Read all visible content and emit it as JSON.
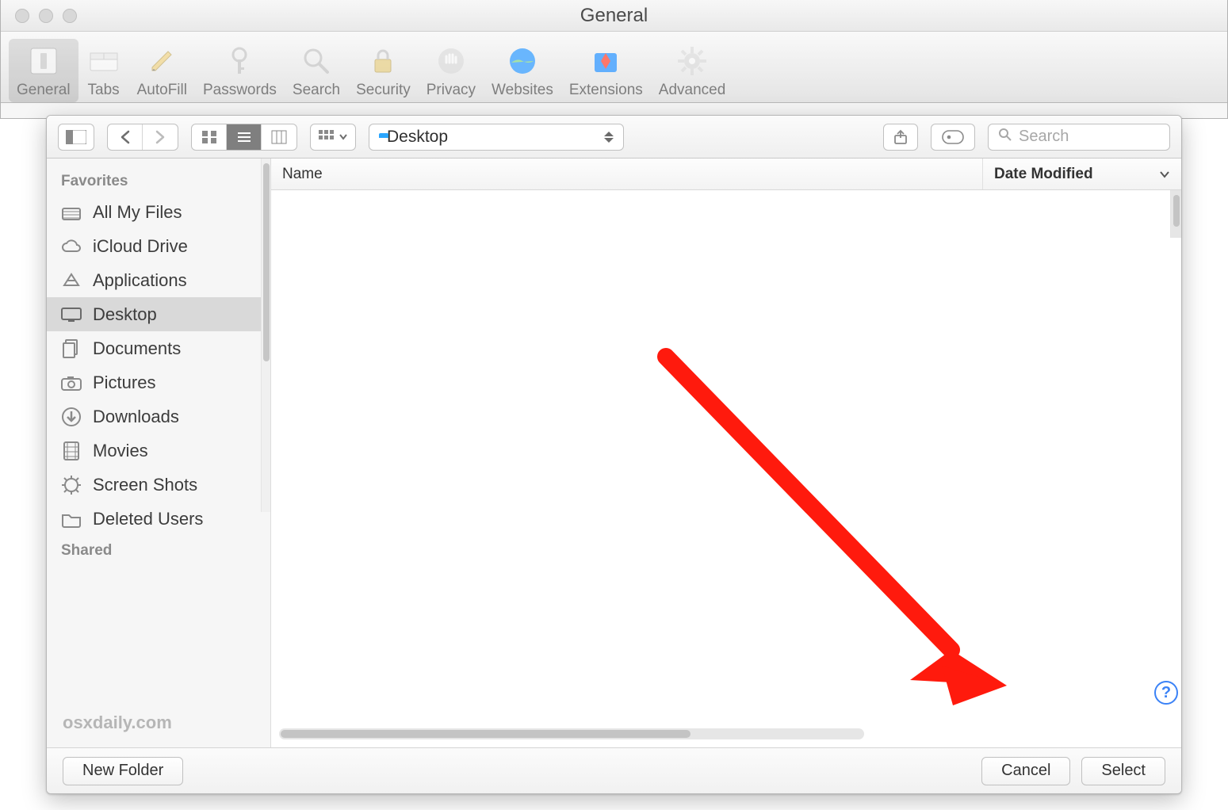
{
  "window": {
    "title": "General"
  },
  "prefs_tabs": {
    "general": "General",
    "tabs": "Tabs",
    "autofill": "AutoFill",
    "passwords": "Passwords",
    "search": "Search",
    "security": "Security",
    "privacy": "Privacy",
    "websites": "Websites",
    "extensions": "Extensions",
    "advanced": "Advanced",
    "selected": "general"
  },
  "open_panel": {
    "location": "Desktop",
    "search_placeholder": "Search",
    "columns": {
      "name": "Name",
      "date_modified": "Date Modified"
    },
    "sidebar": {
      "favorites_heading": "Favorites",
      "shared_heading": "Shared",
      "items": [
        {
          "id": "all-my-files",
          "label": "All My Files",
          "icon": "all-files-icon"
        },
        {
          "id": "icloud-drive",
          "label": "iCloud Drive",
          "icon": "cloud-icon"
        },
        {
          "id": "applications",
          "label": "Applications",
          "icon": "applications-icon"
        },
        {
          "id": "desktop",
          "label": "Desktop",
          "icon": "desktop-icon",
          "selected": true
        },
        {
          "id": "documents",
          "label": "Documents",
          "icon": "documents-icon"
        },
        {
          "id": "pictures",
          "label": "Pictures",
          "icon": "camera-icon"
        },
        {
          "id": "downloads",
          "label": "Downloads",
          "icon": "download-icon"
        },
        {
          "id": "movies",
          "label": "Movies",
          "icon": "film-icon"
        },
        {
          "id": "screen-shots",
          "label": "Screen Shots",
          "icon": "gear-icon"
        },
        {
          "id": "deleted-users",
          "label": "Deleted Users",
          "icon": "folder-icon"
        }
      ]
    },
    "footer": {
      "new_folder": "New Folder",
      "cancel": "Cancel",
      "select": "Select"
    }
  },
  "watermark": "osxdaily.com",
  "annotation": {
    "arrow_color": "#ff1a0d"
  }
}
